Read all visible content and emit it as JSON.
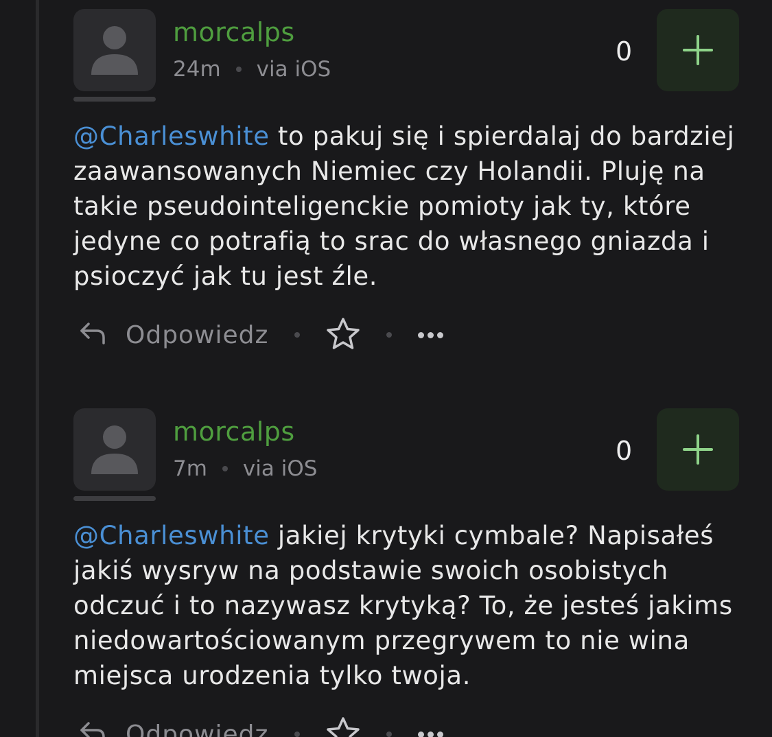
{
  "comments": [
    {
      "author": "morcalps",
      "time": "24m",
      "via": "via iOS",
      "score": "0",
      "mention": "@Charleswhite",
      "text": " to pakuj się i spierdalaj do bardziej zaawansowanych Niemiec czy Holandii. Pluję na takie pseudointeligenckie pomioty jak ty, które jedyne co potrafią to srac do własnego gniazda i psioczyć jak tu jest źle.",
      "reply_label": "Odpowiedz"
    },
    {
      "author": "morcalps",
      "time": "7m",
      "via": "via iOS",
      "score": "0",
      "mention": "@Charleswhite",
      "text": " jakiej krytyki cymbale? Napisałeś jakiś wysryw na podstawie swoich osobistych odczuć i to nazywasz krytyką? To, że jesteś jakims niedowartościowanym przegrywem to nie wina miejsca urodzenia tylko twoja.",
      "reply_label": "Odpowiedz"
    }
  ],
  "icons": {
    "avatar": "user-silhouette-icon",
    "upvote": "plus-icon",
    "reply": "reply-arrow-icon",
    "favorite": "star-icon",
    "more": "more-dots-icon"
  },
  "colors": {
    "background": "#19191b",
    "author": "#4f9e3f",
    "mention": "#4a8fd4",
    "upvote_bg": "#1f2a1e",
    "upvote_icon": "#8fd48a"
  }
}
